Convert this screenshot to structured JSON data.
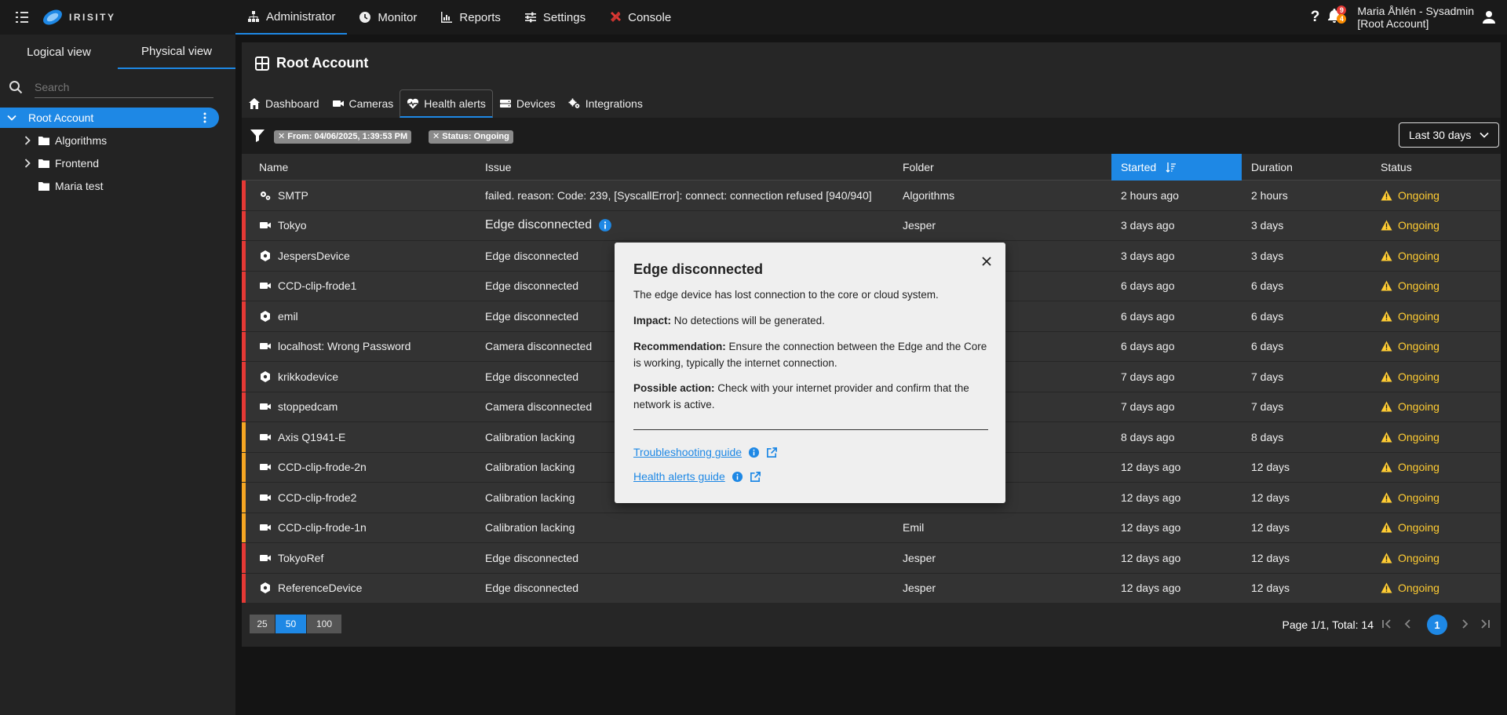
{
  "brand": {
    "name": "IRISITY"
  },
  "nav": {
    "tabs": [
      {
        "label": "Administrator",
        "icon": "sitemap-icon"
      },
      {
        "label": "Monitor",
        "icon": "clock-icon"
      },
      {
        "label": "Reports",
        "icon": "bar-chart-icon"
      },
      {
        "label": "Settings",
        "icon": "sliders-icon"
      },
      {
        "label": "Console",
        "icon": "tools-icon"
      }
    ],
    "help": "?",
    "notifications": {
      "red": "9",
      "orange": "4"
    },
    "user": {
      "name": "Maria Åhlén - Sysadmin",
      "account": "[Root Account]"
    }
  },
  "sidebar": {
    "tabs": [
      "Logical view",
      "Physical view"
    ],
    "search_placeholder": "Search",
    "root": "Root Account",
    "items": [
      {
        "label": "Algorithms",
        "expandable": true
      },
      {
        "label": "Frontend",
        "expandable": true
      },
      {
        "label": "Maria test",
        "expandable": false
      }
    ]
  },
  "main": {
    "title": "Root Account",
    "tabs": [
      {
        "label": "Dashboard",
        "icon": "home-icon"
      },
      {
        "label": "Cameras",
        "icon": "camera-icon"
      },
      {
        "label": "Health alerts",
        "icon": "heart-pulse-icon"
      },
      {
        "label": "Devices",
        "icon": "server-icon"
      },
      {
        "label": "Integrations",
        "icon": "gears-icon"
      }
    ],
    "filters": [
      "✕ From: 04/06/2025, 1:39:53 PM",
      "✕ Status: Ongoing"
    ],
    "range": "Last 30 days"
  },
  "table": {
    "columns": [
      "Name",
      "Issue",
      "Folder",
      "Started",
      "Duration",
      "Status"
    ],
    "rows": [
      {
        "name": "SMTP",
        "type": "gears",
        "issue": "failed. reason: Code: 239, [SyscallError]: connect: connection refused [940/940]",
        "folder": "Algorithms",
        "started": "2 hours ago",
        "duration": "2 hours",
        "status": "Ongoing",
        "severity": "#e53935"
      },
      {
        "name": "Tokyo",
        "type": "camera",
        "issue": "Edge disconnected",
        "folder": "Jesper",
        "started": "3 days ago",
        "duration": "3 days",
        "status": "Ongoing",
        "severity": "#e53935",
        "info": true
      },
      {
        "name": "JespersDevice",
        "type": "device",
        "issue": "Edge disconnected",
        "folder": "",
        "started": "3 days ago",
        "duration": "3 days",
        "status": "Ongoing",
        "severity": "#e53935"
      },
      {
        "name": "CCD-clip-frode1",
        "type": "camera",
        "issue": "Edge disconnected",
        "folder": "",
        "started": "6 days ago",
        "duration": "6 days",
        "status": "Ongoing",
        "severity": "#e53935"
      },
      {
        "name": "emil",
        "type": "device",
        "issue": "Edge disconnected",
        "folder": "",
        "started": "6 days ago",
        "duration": "6 days",
        "status": "Ongoing",
        "severity": "#e53935"
      },
      {
        "name": "localhost: Wrong Password",
        "type": "camera",
        "issue": "Camera disconnected",
        "folder": "",
        "started": "6 days ago",
        "duration": "6 days",
        "status": "Ongoing",
        "severity": "#e53935"
      },
      {
        "name": "krikkodevice",
        "type": "device",
        "issue": "Edge disconnected",
        "folder": "",
        "started": "7 days ago",
        "duration": "7 days",
        "status": "Ongoing",
        "severity": "#e53935"
      },
      {
        "name": "stoppedcam",
        "type": "camera",
        "issue": "Camera disconnected",
        "folder": "",
        "started": "7 days ago",
        "duration": "7 days",
        "status": "Ongoing",
        "severity": "#e53935"
      },
      {
        "name": "Axis Q1941-E",
        "type": "camera",
        "issue": "Calibration lacking",
        "folder": "",
        "started": "8 days ago",
        "duration": "8 days",
        "status": "Ongoing",
        "severity": "#f5a623"
      },
      {
        "name": "CCD-clip-frode-2n",
        "type": "camera",
        "issue": "Calibration lacking",
        "folder": "",
        "started": "12 days ago",
        "duration": "12 days",
        "status": "Ongoing",
        "severity": "#f5a623"
      },
      {
        "name": "CCD-clip-frode2",
        "type": "camera",
        "issue": "Calibration lacking",
        "folder": "",
        "started": "12 days ago",
        "duration": "12 days",
        "status": "Ongoing",
        "severity": "#f5a623"
      },
      {
        "name": "CCD-clip-frode-1n",
        "type": "camera",
        "issue": "Calibration lacking",
        "folder": "Emil",
        "started": "12 days ago",
        "duration": "12 days",
        "status": "Ongoing",
        "severity": "#f5a623"
      },
      {
        "name": "TokyoRef",
        "type": "camera",
        "issue": "Edge disconnected",
        "folder": "Jesper",
        "started": "12 days ago",
        "duration": "12 days",
        "status": "Ongoing",
        "severity": "#e53935"
      },
      {
        "name": "ReferenceDevice",
        "type": "device",
        "issue": "Edge disconnected",
        "folder": "Jesper",
        "started": "12 days ago",
        "duration": "12 days",
        "status": "Ongoing",
        "severity": "#e53935"
      }
    ]
  },
  "pagination": {
    "sizes": [
      "25",
      "50",
      "100"
    ],
    "info": "Page 1/1, Total: 14",
    "current": "1"
  },
  "popover": {
    "title": "Edge disconnected",
    "description": "The edge device has lost connection to the core or cloud system.",
    "impact_label": "Impact:",
    "impact": "No detections will be generated.",
    "recommendation_label": "Recommendation:",
    "recommendation": "Ensure the connection between the Edge and the Core is working, typically the internet connection.",
    "action_label": "Possible action:",
    "action": "Check with your internet provider and confirm that the network is active.",
    "link1": "Troubleshooting guide",
    "link2": "Health alerts guide"
  },
  "colors": {
    "accent": "#1e88e5",
    "critical": "#e53935",
    "warning": "#f5a623",
    "status": "#ffcc33"
  }
}
